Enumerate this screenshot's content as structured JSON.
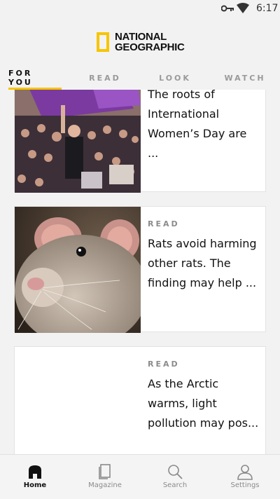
{
  "status_bar": {
    "time": "6:17"
  },
  "logo": {
    "line1": "NATIONAL",
    "line2": "GEOGRAPHIC"
  },
  "tabs": [
    {
      "label": "FOR YOU",
      "active": true
    },
    {
      "label": "READ",
      "active": false
    },
    {
      "label": "LOOK",
      "active": false
    },
    {
      "label": "WATCH",
      "active": false
    }
  ],
  "feed": {
    "cards": [
      {
        "category": "",
        "headline": "The roots of International Women’s Day are ..."
      },
      {
        "category": "READ",
        "headline": "Rats avoid harming other rats. The finding may help ..."
      },
      {
        "category": "READ",
        "headline": "As the Arctic warms, light pollution may pos..."
      }
    ]
  },
  "bottom_nav": {
    "items": [
      {
        "label": "Home",
        "icon": "home-icon",
        "active": true
      },
      {
        "label": "Magazine",
        "icon": "magazine-icon",
        "active": false
      },
      {
        "label": "Search",
        "icon": "search-icon",
        "active": false
      },
      {
        "label": "Settings",
        "icon": "settings-icon",
        "active": false
      }
    ]
  },
  "colors": {
    "accent": "#f6c500",
    "background": "#f2f2f2",
    "card": "#ffffff"
  }
}
